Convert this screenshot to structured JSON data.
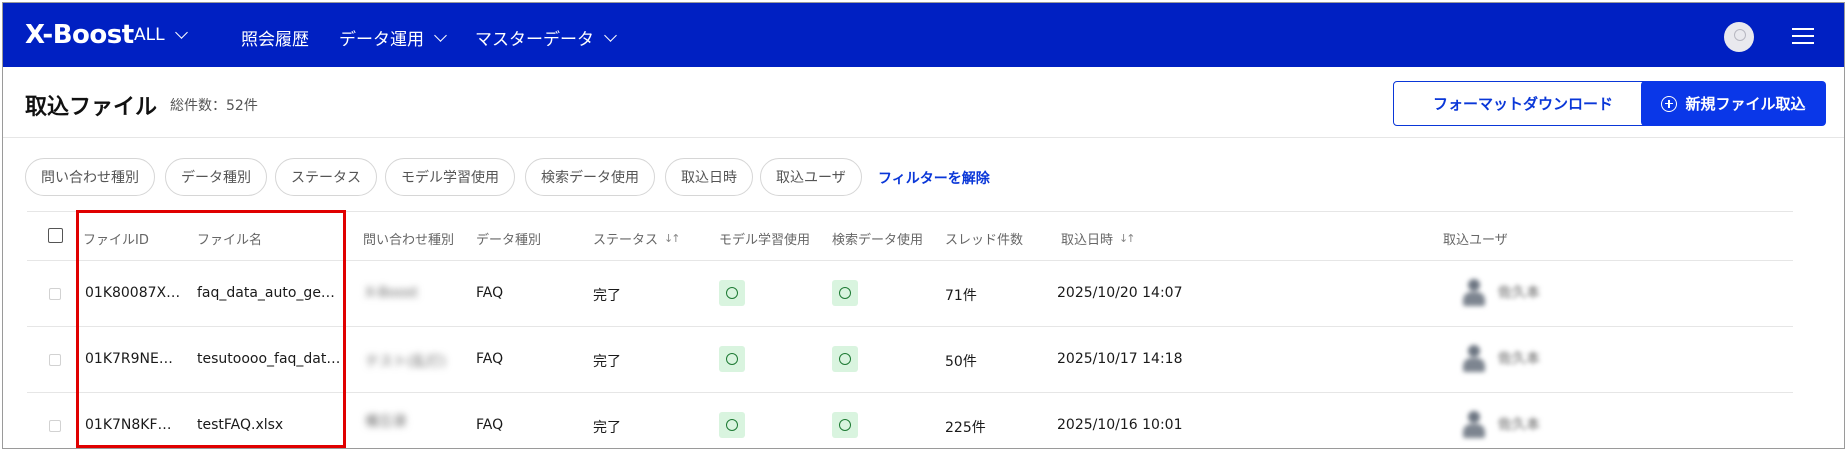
{
  "nav": {
    "logo": "X-Boost",
    "items": [
      {
        "label": "ALL",
        "dropdown": true
      },
      {
        "label": "照会履歴",
        "dropdown": false
      },
      {
        "label": "データ運用",
        "dropdown": true
      },
      {
        "label": "マスターデータ",
        "dropdown": true
      }
    ],
    "icons": [
      "user-avatar-icon",
      "hamburger-menu-icon"
    ],
    "bg_color": "#0020c2"
  },
  "header": {
    "title": "取込ファイル",
    "count": "総件数：52件",
    "download_button": "フォーマットダウンロード",
    "new_import_button": "新規ファイル取込"
  },
  "filters": {
    "chips": [
      "問い合わせ種別",
      "データ種別",
      "ステータス",
      "モデル学習使用",
      "検索データ使用",
      "取込日時",
      "取込ユーザ"
    ],
    "clear_label": "フィルターを解除"
  },
  "table": {
    "columns": [
      "ファイルID",
      "ファイル名",
      "問い合わせ種別",
      "データ種別",
      "ステータス",
      "モデル学習使用",
      "検索データ使用",
      "スレッド件数",
      "取込日時",
      "取込ユーザ"
    ],
    "sortable": [
      "ステータス",
      "取込日時"
    ],
    "rows": [
      {
        "id": "01K80087X…",
        "name": "faq_data_auto_ge…",
        "inquiry": "X-Boost",
        "data_type": "FAQ",
        "status": "完了",
        "threads": "71件",
        "date": "2025/10/20 14:07",
        "user": "佐久本"
      },
      {
        "id": "01K7R9NE…",
        "name": "tesutoooo_faq_dat…",
        "inquiry": "テスト(乱打)",
        "data_type": "FAQ",
        "status": "完了",
        "threads": "50件",
        "date": "2025/10/17 14:18",
        "user": "佐久本"
      },
      {
        "id": "01K7N8KF…",
        "name": "testFAQ.xlsx",
        "inquiry": "備忘录",
        "data_type": "FAQ",
        "status": "完了",
        "threads": "225件",
        "date": "2025/10/16 10:01",
        "user": "佐久本"
      }
    ],
    "ok_badge_color": "#d9f4df"
  },
  "accent_color": "#0a37e8",
  "highlight_color": "#e00000"
}
